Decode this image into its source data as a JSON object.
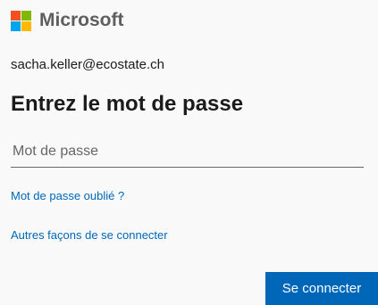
{
  "brand": {
    "name": "Microsoft",
    "logo_colors": [
      "#f25022",
      "#7fba00",
      "#00a4ef",
      "#ffb900"
    ]
  },
  "account": {
    "identity": "sacha.keller@ecostate.ch"
  },
  "page": {
    "title": "Entrez le mot de passe"
  },
  "form": {
    "password_placeholder": "Mot de passe",
    "password_value": ""
  },
  "links": {
    "forgot_password": "Mot de passe oublié ?",
    "other_ways": "Autres façons de se connecter"
  },
  "actions": {
    "submit_label": "Se connecter"
  },
  "colors": {
    "accent": "#0067b8",
    "background": "#f9f9f9"
  }
}
